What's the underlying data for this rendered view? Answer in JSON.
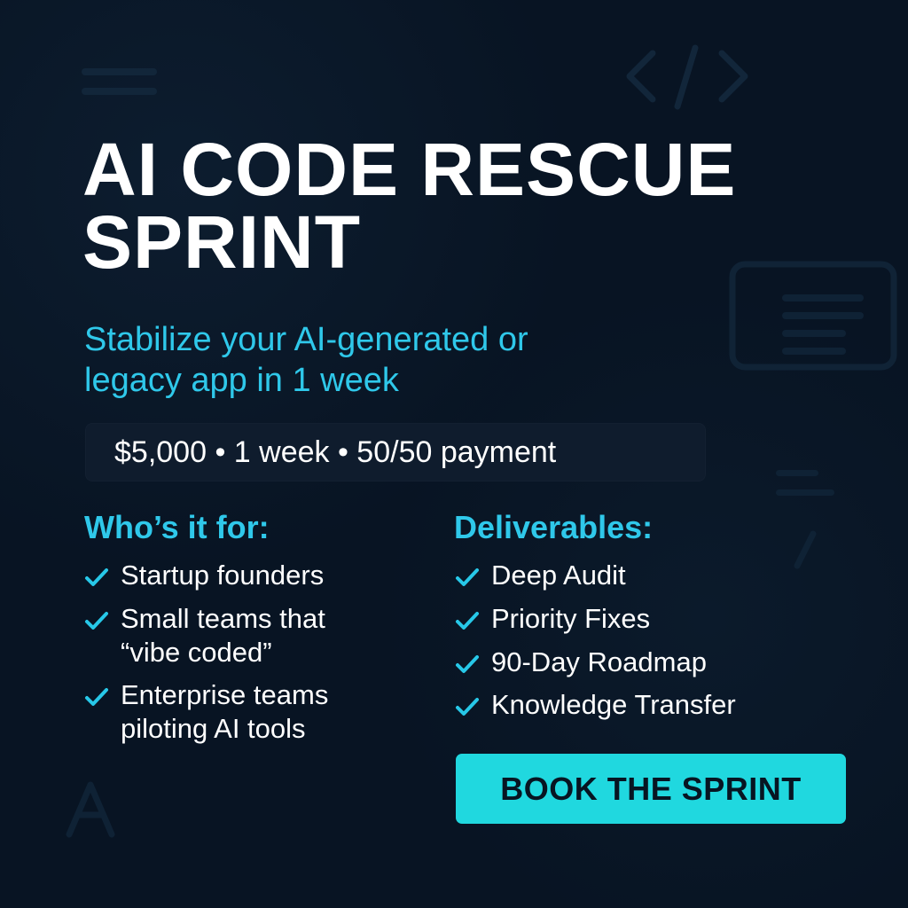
{
  "hero": {
    "title_lines": [
      "AI CODE RESCUE",
      "SPRINT"
    ],
    "subtitle_lines": [
      "Stabilize your AI-generated or",
      "legacy app in 1 week"
    ],
    "pricing_text": "$5,000 • 1 week  •  50/50 payment"
  },
  "sections": {
    "who": {
      "title": "Who’s it for:",
      "items": [
        {
          "lines": [
            "Startup founders"
          ]
        },
        {
          "lines": [
            "Small teams that",
            "“vibe coded”"
          ]
        },
        {
          "lines": [
            "Enterprise teams",
            "piloting AI tools"
          ]
        }
      ]
    },
    "deliverables": {
      "title": "Deliverables:",
      "items": [
        {
          "lines": [
            "Deep Audit"
          ]
        },
        {
          "lines": [
            "Priority Fixes"
          ]
        },
        {
          "lines": [
            "90-Day Roadmap"
          ]
        },
        {
          "lines": [
            "Knowledge Transfer"
          ]
        }
      ]
    }
  },
  "cta": {
    "label": "BOOK THE SPRINT"
  },
  "icons": {
    "check": "check-icon",
    "menu": "menu-lines-icon",
    "code": "code-icon",
    "document": "document-icon",
    "pen": "pen-icon",
    "letter": "letter-a-icon"
  },
  "colors": {
    "background": "#081423",
    "accent": "#2fc8ea",
    "button": "#20d8df",
    "text": "#ffffff",
    "pill": "#0f1c2d"
  }
}
